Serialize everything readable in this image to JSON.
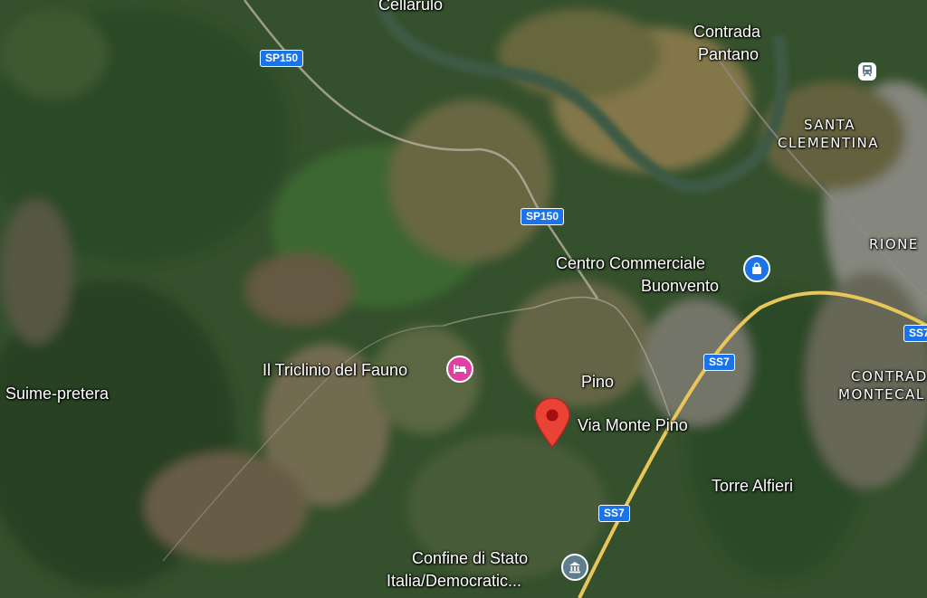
{
  "map": {
    "view": "satellite",
    "place_labels": {
      "cellarulo": "Cellarulo",
      "contrada_pantano_1": "Contrada",
      "contrada_pantano_2": "Pantano",
      "santa_clementina_1": "SANTA",
      "santa_clementina_2": "CLEMENTINA",
      "rione": "RIONE",
      "contrada_montecal_1": "CONTRAD",
      "contrada_montecal_2": "MONTECAL",
      "suime_pretera": "Suime-pretera",
      "pino": "Pino",
      "torre_alfieri": "Torre Alfieri"
    },
    "road_shields": {
      "sp150_top": "SP150",
      "sp150_mid": "SP150",
      "ss7_mid": "SS7",
      "ss7_low": "SS7",
      "ss7_right": "SS7"
    },
    "pois": {
      "hotel": {
        "name": "Il Triclinio del Fauno",
        "icon": "bed-icon",
        "color": "#e040a0"
      },
      "shopping": {
        "name_line1": "Centro Commerciale",
        "name_line2": "Buonvento",
        "icon": "shopping-bag-icon",
        "color": "#1a73e8"
      },
      "government": {
        "name_line1": "Confine di Stato",
        "name_line2": "Italia/Democratic...",
        "icon": "government-building-icon",
        "color": "#5f7d8c"
      }
    },
    "pin": {
      "label": "Via Monte Pino",
      "icon": "map-pin-icon",
      "color": "#ea4335"
    },
    "station_icon": "train-station-icon"
  }
}
